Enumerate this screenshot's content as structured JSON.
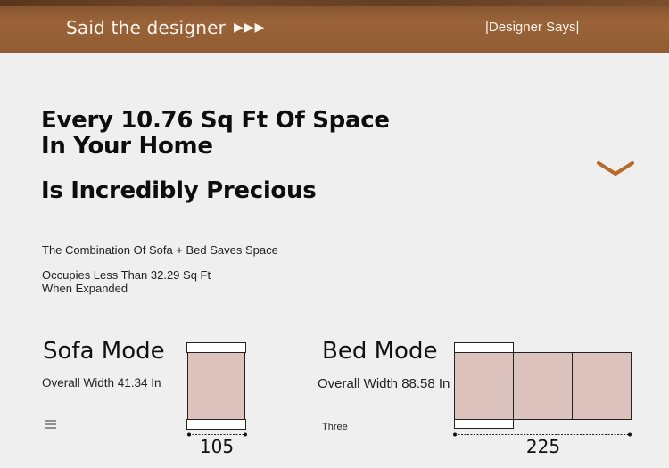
{
  "banner": {
    "left_text": "Said the designer",
    "arrows": "▶▶▶",
    "right_text": "|Designer Says|"
  },
  "headline": {
    "line1": "Every 10.76 Sq Ft Of Space",
    "line2": "In Your Home",
    "line3": "Is Incredibly Precious"
  },
  "details": {
    "combination": "The Combination Of Sofa + Bed Saves Space",
    "occupies_line1": "Occupies Less Than 32.29 Sq Ft",
    "occupies_line2": "When Expanded"
  },
  "sofa_mode": {
    "title": "Sofa Mode",
    "width": "Overall Width 41.34 In",
    "dimension": "105"
  },
  "bed_mode": {
    "title": "Bed Mode",
    "width": "Overall Width 88.58 In",
    "dimension": "225",
    "note": "Three"
  },
  "colors": {
    "banner": "#915c33",
    "cushion": "#dcc3be",
    "background": "#efefef",
    "accent": "#b86a2a"
  },
  "icons": [
    "play-arrows-icon",
    "chevron-down-icon",
    "menu-icon"
  ]
}
